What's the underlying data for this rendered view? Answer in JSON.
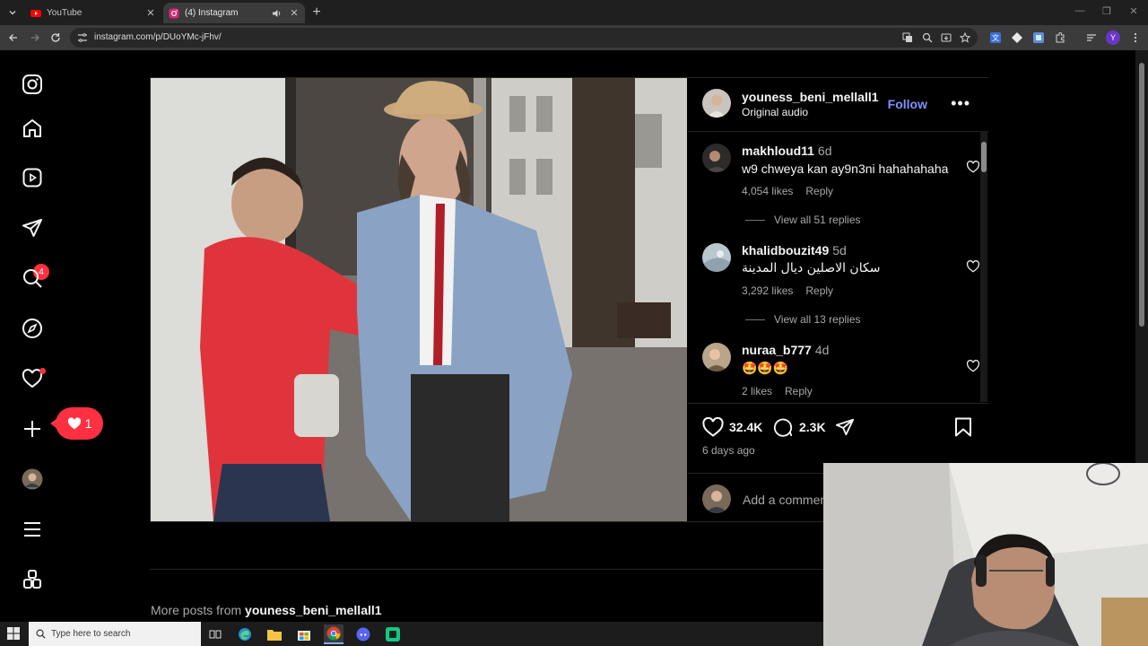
{
  "browser": {
    "tabs": [
      {
        "title": "YouTube",
        "icon": "youtube-icon",
        "active": false
      },
      {
        "title": "(4) Instagram",
        "icon": "instagram-icon",
        "active": true
      }
    ],
    "url": "instagram.com/p/DUoYMc-jFhv/",
    "profile_letter": "Y"
  },
  "rail": {
    "messages_badge": "4",
    "notification_count": "1"
  },
  "post": {
    "author": "youness_beni_mellall1",
    "audio": "Original audio",
    "follow_label": "Follow",
    "likes": "32.4K",
    "comment_count": "2.3K",
    "posted": "6 days ago",
    "add_comment_placeholder": "Add a comment..."
  },
  "comments": [
    {
      "user": "makhloud11",
      "time": "6d",
      "text": "w9 chweya kan ay9n3ni hahahahaha",
      "likes": "4,054 likes",
      "reply": "Reply",
      "replies": "View all 51 replies"
    },
    {
      "user": "khalidbouzit49",
      "time": "5d",
      "text": "سكان الاصلين ديال المدينة",
      "likes": "3,292 likes",
      "reply": "Reply",
      "replies": "View all 13 replies"
    },
    {
      "user": "nuraa_b777",
      "time": "4d",
      "text": "🤩🤩🤩",
      "likes": "2 likes",
      "reply": "Reply"
    }
  ],
  "more_posts": {
    "prefix": "More posts from",
    "user": "youness_beni_mellall1"
  },
  "taskbar": {
    "search_placeholder": "Type here to search"
  },
  "colors": {
    "accent_follow": "#7f91ff",
    "notification_red": "#ff3040",
    "background": "#000000"
  }
}
